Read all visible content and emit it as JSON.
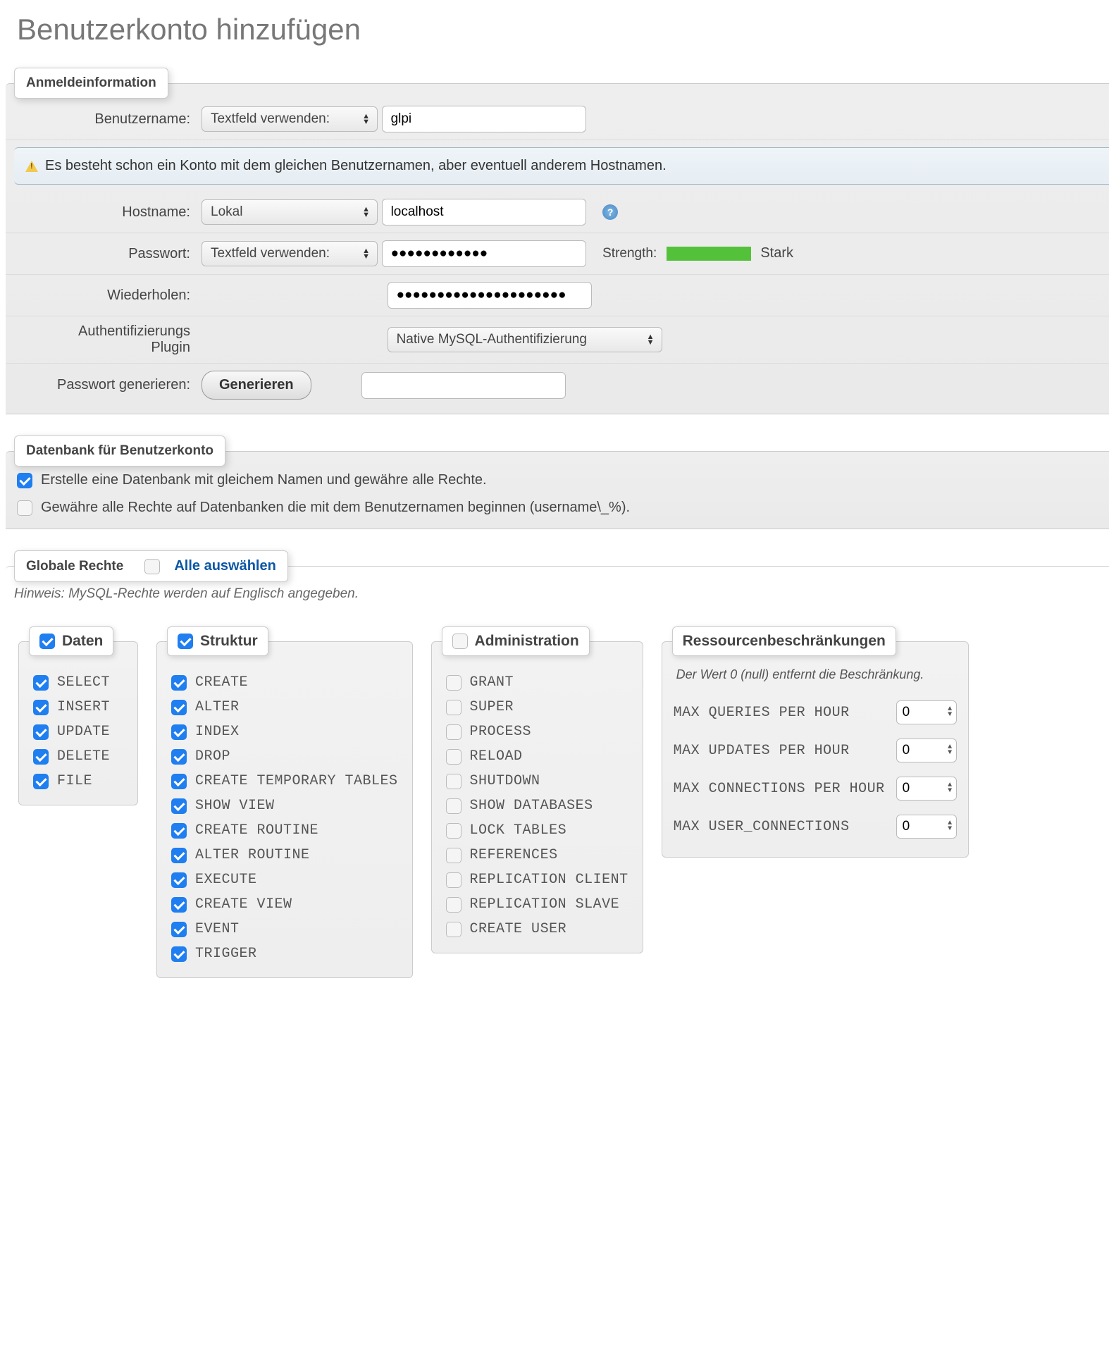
{
  "page_title": "Benutzerkonto hinzufügen",
  "login_info": {
    "legend": "Anmeldeinformation",
    "username_label": "Benutzername:",
    "username_select": "Textfeld verwenden:",
    "username_value": "glpi",
    "warning_text": "Es besteht schon ein Konto mit dem gleichen Benutzernamen, aber eventuell anderem Hostnamen.",
    "hostname_label": "Hostname:",
    "hostname_select": "Lokal",
    "hostname_value": "localhost",
    "password_label": "Passwort:",
    "password_select": "Textfeld verwenden:",
    "password_value": "●●●●●●●●●●●●",
    "strength_label": "Strength:",
    "strength_text": "Stark",
    "retype_label": "Wiederholen:",
    "retype_value": "●●●●●●●●●●●●●●●●●●●●●",
    "auth_label_line1": "Authentifizierungs",
    "auth_label_line2": "Plugin",
    "auth_select": "Native MySQL-Authentifizierung",
    "generate_label": "Passwort generieren:",
    "generate_btn": "Generieren",
    "generated_value": ""
  },
  "db_section": {
    "legend": "Datenbank für Benutzerkonto",
    "create_same": "Erstelle eine Datenbank mit gleichem Namen und gewähre alle Rechte.",
    "grant_wildcard": "Gewähre alle Rechte auf Datenbanken die mit dem Benutzernamen beginnen (username\\_%)."
  },
  "global_rights": {
    "legend": "Globale Rechte",
    "select_all": "Alle auswählen",
    "note": "Hinweis: MySQL-Rechte werden auf Englisch angegeben.",
    "groups": {
      "data": {
        "title": "Daten",
        "checked": true,
        "items": [
          {
            "label": "SELECT",
            "checked": true
          },
          {
            "label": "INSERT",
            "checked": true
          },
          {
            "label": "UPDATE",
            "checked": true
          },
          {
            "label": "DELETE",
            "checked": true
          },
          {
            "label": "FILE",
            "checked": true
          }
        ]
      },
      "structure": {
        "title": "Struktur",
        "checked": true,
        "items": [
          {
            "label": "CREATE",
            "checked": true
          },
          {
            "label": "ALTER",
            "checked": true
          },
          {
            "label": "INDEX",
            "checked": true
          },
          {
            "label": "DROP",
            "checked": true
          },
          {
            "label": "CREATE TEMPORARY TABLES",
            "checked": true
          },
          {
            "label": "SHOW VIEW",
            "checked": true
          },
          {
            "label": "CREATE ROUTINE",
            "checked": true
          },
          {
            "label": "ALTER ROUTINE",
            "checked": true
          },
          {
            "label": "EXECUTE",
            "checked": true
          },
          {
            "label": "CREATE VIEW",
            "checked": true
          },
          {
            "label": "EVENT",
            "checked": true
          },
          {
            "label": "TRIGGER",
            "checked": true
          }
        ]
      },
      "admin": {
        "title": "Administration",
        "checked": false,
        "items": [
          {
            "label": "GRANT",
            "checked": false
          },
          {
            "label": "SUPER",
            "checked": false
          },
          {
            "label": "PROCESS",
            "checked": false
          },
          {
            "label": "RELOAD",
            "checked": false
          },
          {
            "label": "SHUTDOWN",
            "checked": false
          },
          {
            "label": "SHOW DATABASES",
            "checked": false
          },
          {
            "label": "LOCK TABLES",
            "checked": false
          },
          {
            "label": "REFERENCES",
            "checked": false
          },
          {
            "label": "REPLICATION CLIENT",
            "checked": false
          },
          {
            "label": "REPLICATION SLAVE",
            "checked": false
          },
          {
            "label": "CREATE USER",
            "checked": false
          }
        ]
      },
      "resources": {
        "title": "Ressourcenbeschränkungen",
        "note": "Der Wert 0 (null) entfernt die Beschränkung.",
        "rows": [
          {
            "label": "MAX QUERIES PER HOUR",
            "value": "0"
          },
          {
            "label": "MAX UPDATES PER HOUR",
            "value": "0"
          },
          {
            "label": "MAX CONNECTIONS PER HOUR",
            "value": "0"
          },
          {
            "label": "MAX USER_CONNECTIONS",
            "value": "0"
          }
        ]
      }
    }
  }
}
